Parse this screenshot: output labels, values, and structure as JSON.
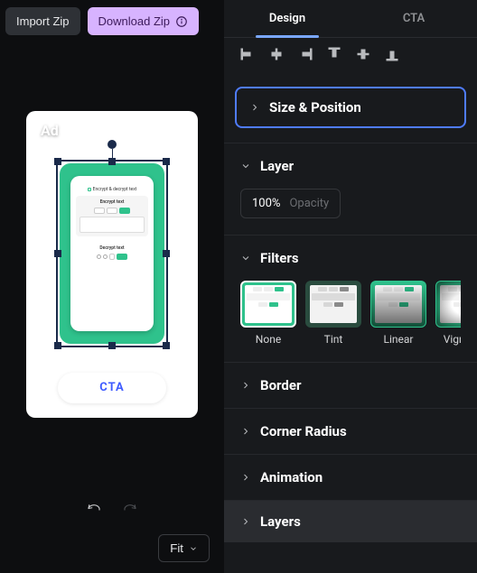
{
  "toolbar": {
    "import": "Import Zip",
    "download": "Download Zip"
  },
  "canvas": {
    "ad_label": "Ad",
    "cta_label": "CTA",
    "phone": {
      "header": "Encrypt & decrypt text",
      "sec1": "Encrypt text",
      "sec2": "Decrypt text"
    }
  },
  "footer": {
    "fit": "Fit"
  },
  "tabs": {
    "design": "Design",
    "cta": "CTA"
  },
  "panels": {
    "size_position": "Size & Position",
    "layer": "Layer",
    "opacity_value": "100%",
    "opacity_label": "Opacity",
    "filters": "Filters",
    "border": "Border",
    "corner_radius": "Corner Radius",
    "animation": "Animation",
    "layers": "Layers"
  },
  "filters": {
    "items": [
      {
        "label": "None"
      },
      {
        "label": "Tint"
      },
      {
        "label": "Linear"
      },
      {
        "label": "Vignette"
      }
    ]
  }
}
